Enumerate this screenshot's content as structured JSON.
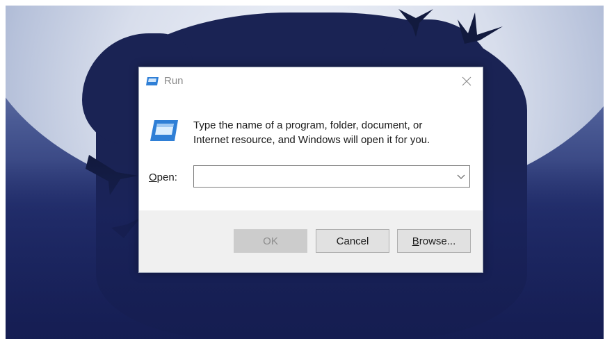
{
  "dialog": {
    "title": "Run",
    "close_glyph": "✕",
    "description_line1": "Type the name of a program, folder, document, or",
    "description_line2": "Internet resource, and Windows will open it for you.",
    "open_label_mnemonic": "O",
    "open_label_rest": "pen:",
    "open_value": "",
    "open_placeholder": "",
    "buttons": {
      "ok": "OK",
      "cancel": "Cancel",
      "browse_mnemonic": "B",
      "browse_rest": "rowse..."
    },
    "icons": {
      "title": "run-icon",
      "large": "run-icon",
      "dropdown": "chevron-down-icon",
      "close": "close-icon"
    }
  },
  "colors": {
    "ok_disabled_bg": "#cccccc",
    "footer_bg": "#f0f0f0",
    "accent_icon": "#2f7fd6"
  }
}
